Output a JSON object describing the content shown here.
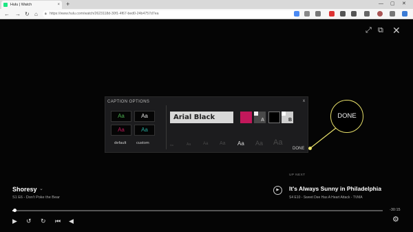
{
  "browser": {
    "tab_title": "Hulu | Watch",
    "tab_close": "×",
    "new_tab": "+",
    "url": "https://www.hulu.com/watch/2623118d-30f1-4f67-bed0-24b4757d7ea",
    "window_controls": [
      "—",
      "▢",
      "✕"
    ]
  },
  "colors": {
    "hulu_green": "#1ce783",
    "accent_yellow": "#f0e66c",
    "caption_bg_magenta": "#c2185b"
  },
  "caption_options": {
    "title": "CAPTION OPTIONS",
    "close": "x",
    "swatches": [
      {
        "text": "Aa",
        "color": "#4caf50"
      },
      {
        "text": "Aa",
        "color": "#e0e0e0"
      },
      {
        "text": "Aa",
        "color": "#c2185b"
      },
      {
        "text": "Aa",
        "color": "#26a69a"
      }
    ],
    "preset_default": "default",
    "preset_custom": "custom",
    "font": "Arial Black",
    "text_color_letter": "A",
    "bg_color_letter": "B",
    "sizes": [
      "Aa",
      "Aa",
      "Aa",
      "Aa",
      "Aa",
      "Aa",
      "Aa",
      "Aa"
    ],
    "done": "DONE"
  },
  "callout": {
    "label": "DONE"
  },
  "now_playing": {
    "title": "Shoresy",
    "subtitle": "S1 E6 - Don't Poke the Bear"
  },
  "up_next": {
    "label": "UP NEXT",
    "title": "It's Always Sunny in Philadelphia",
    "subtitle": "S4 E10 - Sweet Dee Has A Heart Attack - TVMA"
  },
  "playback": {
    "time_remaining": "-30:15",
    "progress_fraction": 0.005
  }
}
